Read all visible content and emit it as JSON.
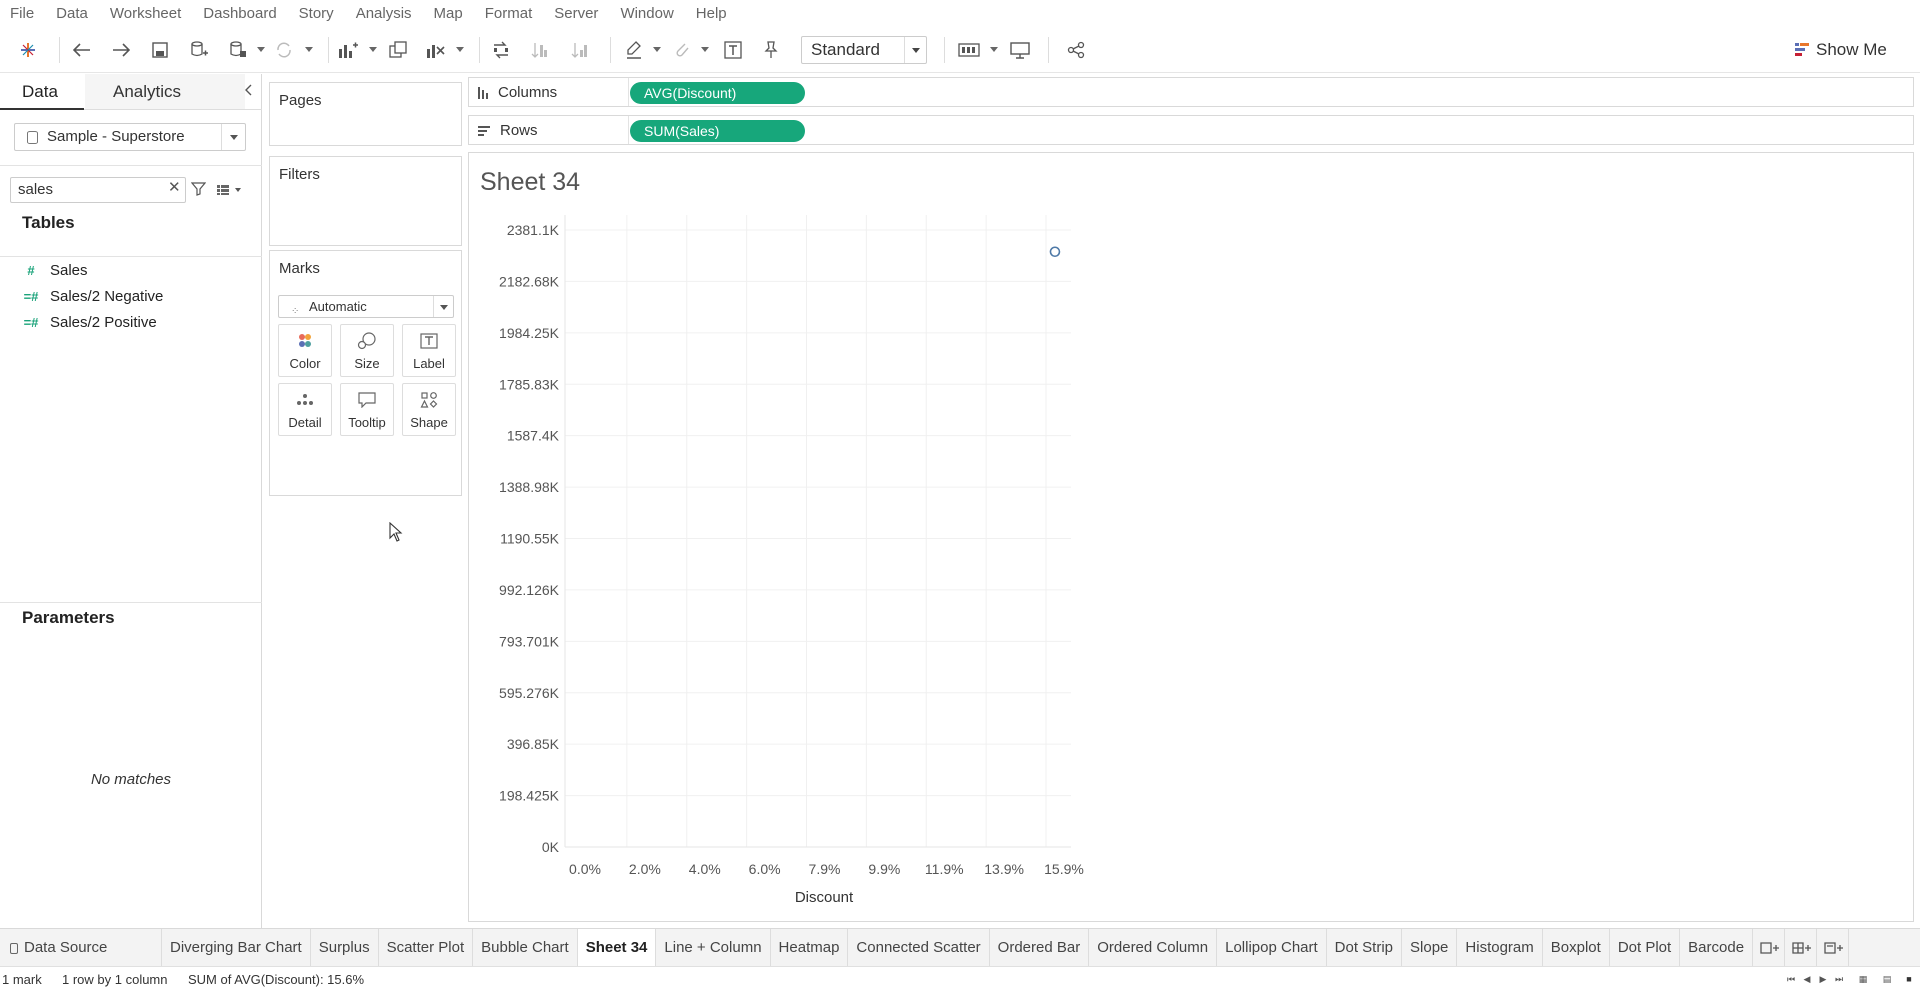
{
  "menu": [
    "File",
    "Data",
    "Worksheet",
    "Dashboard",
    "Story",
    "Analysis",
    "Map",
    "Format",
    "Server",
    "Window",
    "Help"
  ],
  "toolbar": {
    "fit_select": "Standard",
    "show_me": "Show Me"
  },
  "left_pane": {
    "tab_data": "Data",
    "tab_analytics": "Analytics",
    "datasource": "Sample - Superstore",
    "search_value": "sales",
    "tables_title": "Tables",
    "fields": [
      {
        "name": "Sales",
        "icon": "#"
      },
      {
        "name": "Sales/2 Negative",
        "icon": "=#"
      },
      {
        "name": "Sales/2 Positive",
        "icon": "=#"
      }
    ],
    "parameters_title": "Parameters",
    "no_matches": "No matches"
  },
  "cards": {
    "pages": "Pages",
    "filters": "Filters",
    "marks": "Marks",
    "marks_type": "Automatic",
    "mark_buttons": [
      "Color",
      "Size",
      "Label",
      "Detail",
      "Tooltip",
      "Shape"
    ]
  },
  "shelves": {
    "columns_label": "Columns",
    "columns_pill": "AVG(Discount)",
    "rows_label": "Rows",
    "rows_pill": "SUM(Sales)"
  },
  "sheet_title": "Sheet 34",
  "chart_data": {
    "type": "scatter",
    "xlabel": "Discount",
    "ylabel": "",
    "x_ticks": [
      "0.0%",
      "2.0%",
      "4.0%",
      "6.0%",
      "7.9%",
      "9.9%",
      "11.9%",
      "13.9%",
      "15.9%"
    ],
    "y_ticks": [
      "0K",
      "198.425K",
      "396.85K",
      "595.276K",
      "793.701K",
      "992.126K",
      "1190.55K",
      "1388.98K",
      "1587.4K",
      "1785.83K",
      "1984.25K",
      "2182.68K",
      "2381.1K"
    ],
    "xlim": [
      0,
      0.165
    ],
    "ylim": [
      0,
      2381100
    ],
    "points": [
      {
        "x": 0.156,
        "y": 2297201
      }
    ],
    "mark_color": "#4e79a7",
    "grid": true
  },
  "sheet_tabs": [
    "Diverging Bar Chart",
    "Surplus",
    "Scatter Plot",
    "Bubble Chart",
    "Sheet 34",
    "Line + Column",
    "Heatmap",
    "Connected Scatter",
    "Ordered Bar",
    "Ordered Column",
    "Lollipop Chart",
    "Dot Strip",
    "Slope",
    "Histogram",
    "Boxplot",
    "Dot Plot",
    "Barcode"
  ],
  "active_tab": "Sheet 34",
  "datasource_tab": "Data Source",
  "status": {
    "marks": "1 mark",
    "rows_cols": "1 row by 1 column",
    "summary": "SUM of AVG(Discount): 15.6%"
  }
}
